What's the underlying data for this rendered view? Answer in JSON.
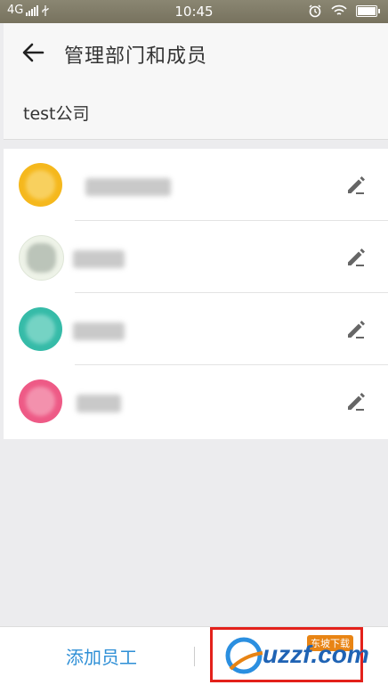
{
  "status_bar": {
    "network": "4G",
    "time": "10:45"
  },
  "header": {
    "title": "管理部门和成员"
  },
  "company": {
    "name": "test公司"
  },
  "members": [
    {
      "avatar_color": "#f5b81d",
      "name_hidden": true
    },
    {
      "avatar_color": "#eef3e8",
      "name_hidden": true
    },
    {
      "avatar_color": "#36bba8",
      "name_hidden": true
    },
    {
      "avatar_color": "#ee5a86",
      "name_hidden": true
    }
  ],
  "bottom_bar": {
    "add_label": "添加员工"
  },
  "watermark": {
    "brand": "uzzf.com",
    "tag": "东坡下载"
  },
  "colors": {
    "accent": "#2e8fd6",
    "background": "#ececee",
    "watermark_border": "#e3211b"
  }
}
